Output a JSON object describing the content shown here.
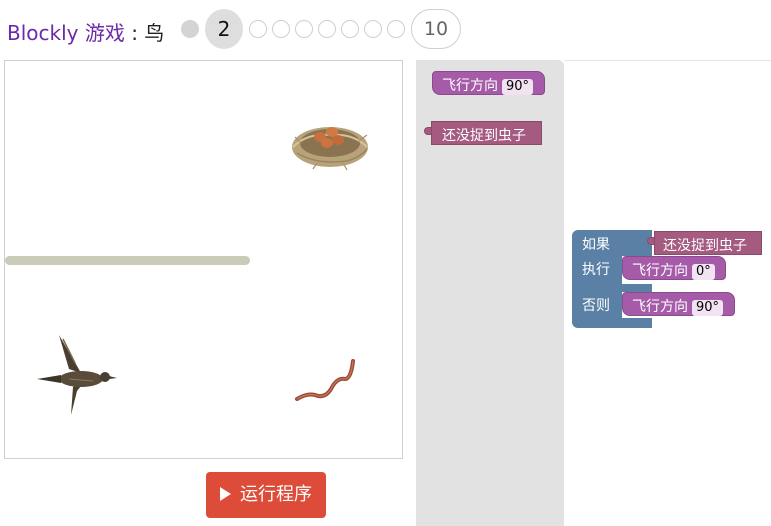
{
  "header": {
    "app_name": "Blockly",
    "game_name": "游戏",
    "separator": " : ",
    "level_name": "鸟",
    "current_level": "2",
    "last_level": "10"
  },
  "controls": {
    "run_label": "运行程序"
  },
  "toolbox": {
    "heading_block": {
      "label": "飞行方向",
      "value": "90°"
    },
    "condition_block": {
      "label": "还没捉到虫子"
    }
  },
  "workspace": {
    "if_block": {
      "if_label": "如果",
      "condition": "还没捉到虫子",
      "do_label": "执行",
      "do_action": {
        "label": "飞行方向",
        "value": "0°"
      },
      "else_label": "否则",
      "else_action": {
        "label": "飞行方向",
        "value": "90°"
      }
    }
  },
  "colors": {
    "title_purple": "#6b2aa8",
    "run_button": "#dd4b39",
    "block_purple": "#a55ba8",
    "block_pink": "#a55b80",
    "block_slate": "#5b80a5",
    "toolbox_bg": "#e2e2e2"
  }
}
